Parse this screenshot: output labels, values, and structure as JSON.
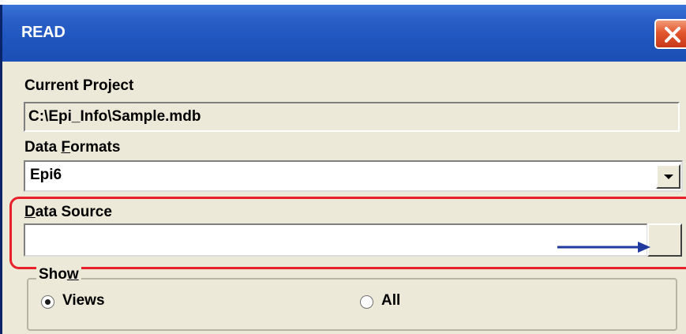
{
  "window": {
    "title": "READ",
    "close_icon": "close-icon"
  },
  "current_project": {
    "label": "Current Project",
    "value": "C:\\Epi_Info\\Sample.mdb"
  },
  "data_formats": {
    "label_pre": "Data ",
    "label_mnemonic": "F",
    "label_post": "ormats",
    "selected": "Epi6",
    "dropdown_icon": "chevron-down-icon"
  },
  "data_source": {
    "label_mnemonic": "D",
    "label_post": "ata Source",
    "value": "",
    "browse_label": ""
  },
  "show": {
    "label_pre": "Sho",
    "label_mnemonic": "w",
    "options": [
      {
        "label": "Views",
        "selected": true
      },
      {
        "label": "All",
        "selected": false
      }
    ]
  },
  "annotation": {
    "highlight_color": "#e8202a",
    "arrow_color": "#1f3a9c"
  }
}
